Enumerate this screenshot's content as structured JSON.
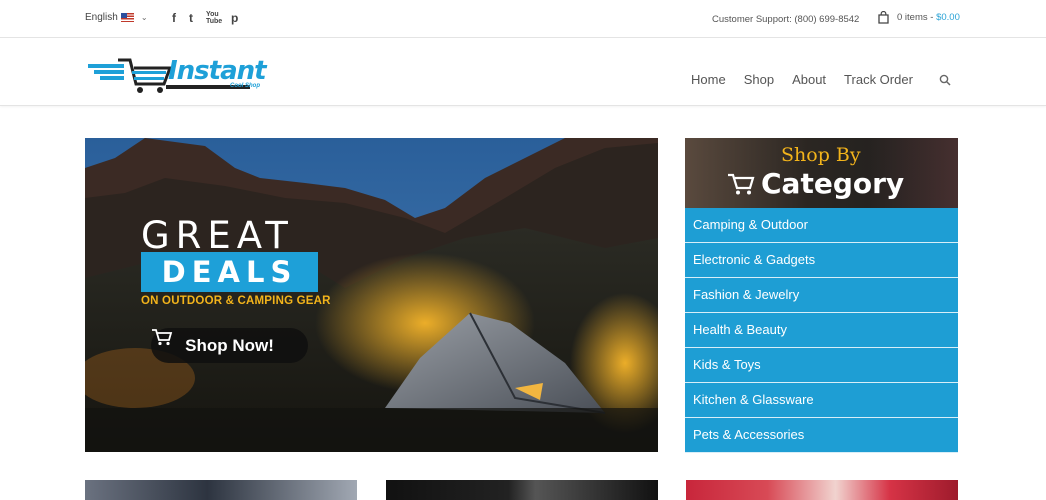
{
  "topbar": {
    "language": "English",
    "socials": [
      "f",
      "t",
      "You Tube",
      "p"
    ],
    "support_text": "Customer Support: (800) 699-8542",
    "cart_items": "0 items",
    "cart_separator": "-",
    "cart_total": "$0.00"
  },
  "header": {
    "logo_text": "Instant",
    "logo_sub": "Cool Shop",
    "nav": [
      "Home",
      "Shop",
      "About",
      "Track Order"
    ]
  },
  "hero": {
    "line1": "GREAT",
    "line2": "DEALS",
    "subtitle": "ON OUTDOOR & CAMPING GEAR",
    "button": "Shop Now!"
  },
  "categories": {
    "shop_by": "Shop By",
    "title": "Category",
    "items": [
      "Camping & Outdoor",
      "Electronic & Gadgets",
      "Fashion & Jewelry",
      "Health & Beauty",
      "Kids & Toys",
      "Kitchen & Glassware",
      "Pets & Accessories"
    ]
  },
  "colors": {
    "accent": "#1ea0d8",
    "highlight": "#f3b41b"
  },
  "icons": [
    "us-flag-icon",
    "facebook-icon",
    "twitter-icon",
    "youtube-icon",
    "pinterest-icon",
    "shopping-bag-icon",
    "search-icon",
    "cart-icon"
  ]
}
